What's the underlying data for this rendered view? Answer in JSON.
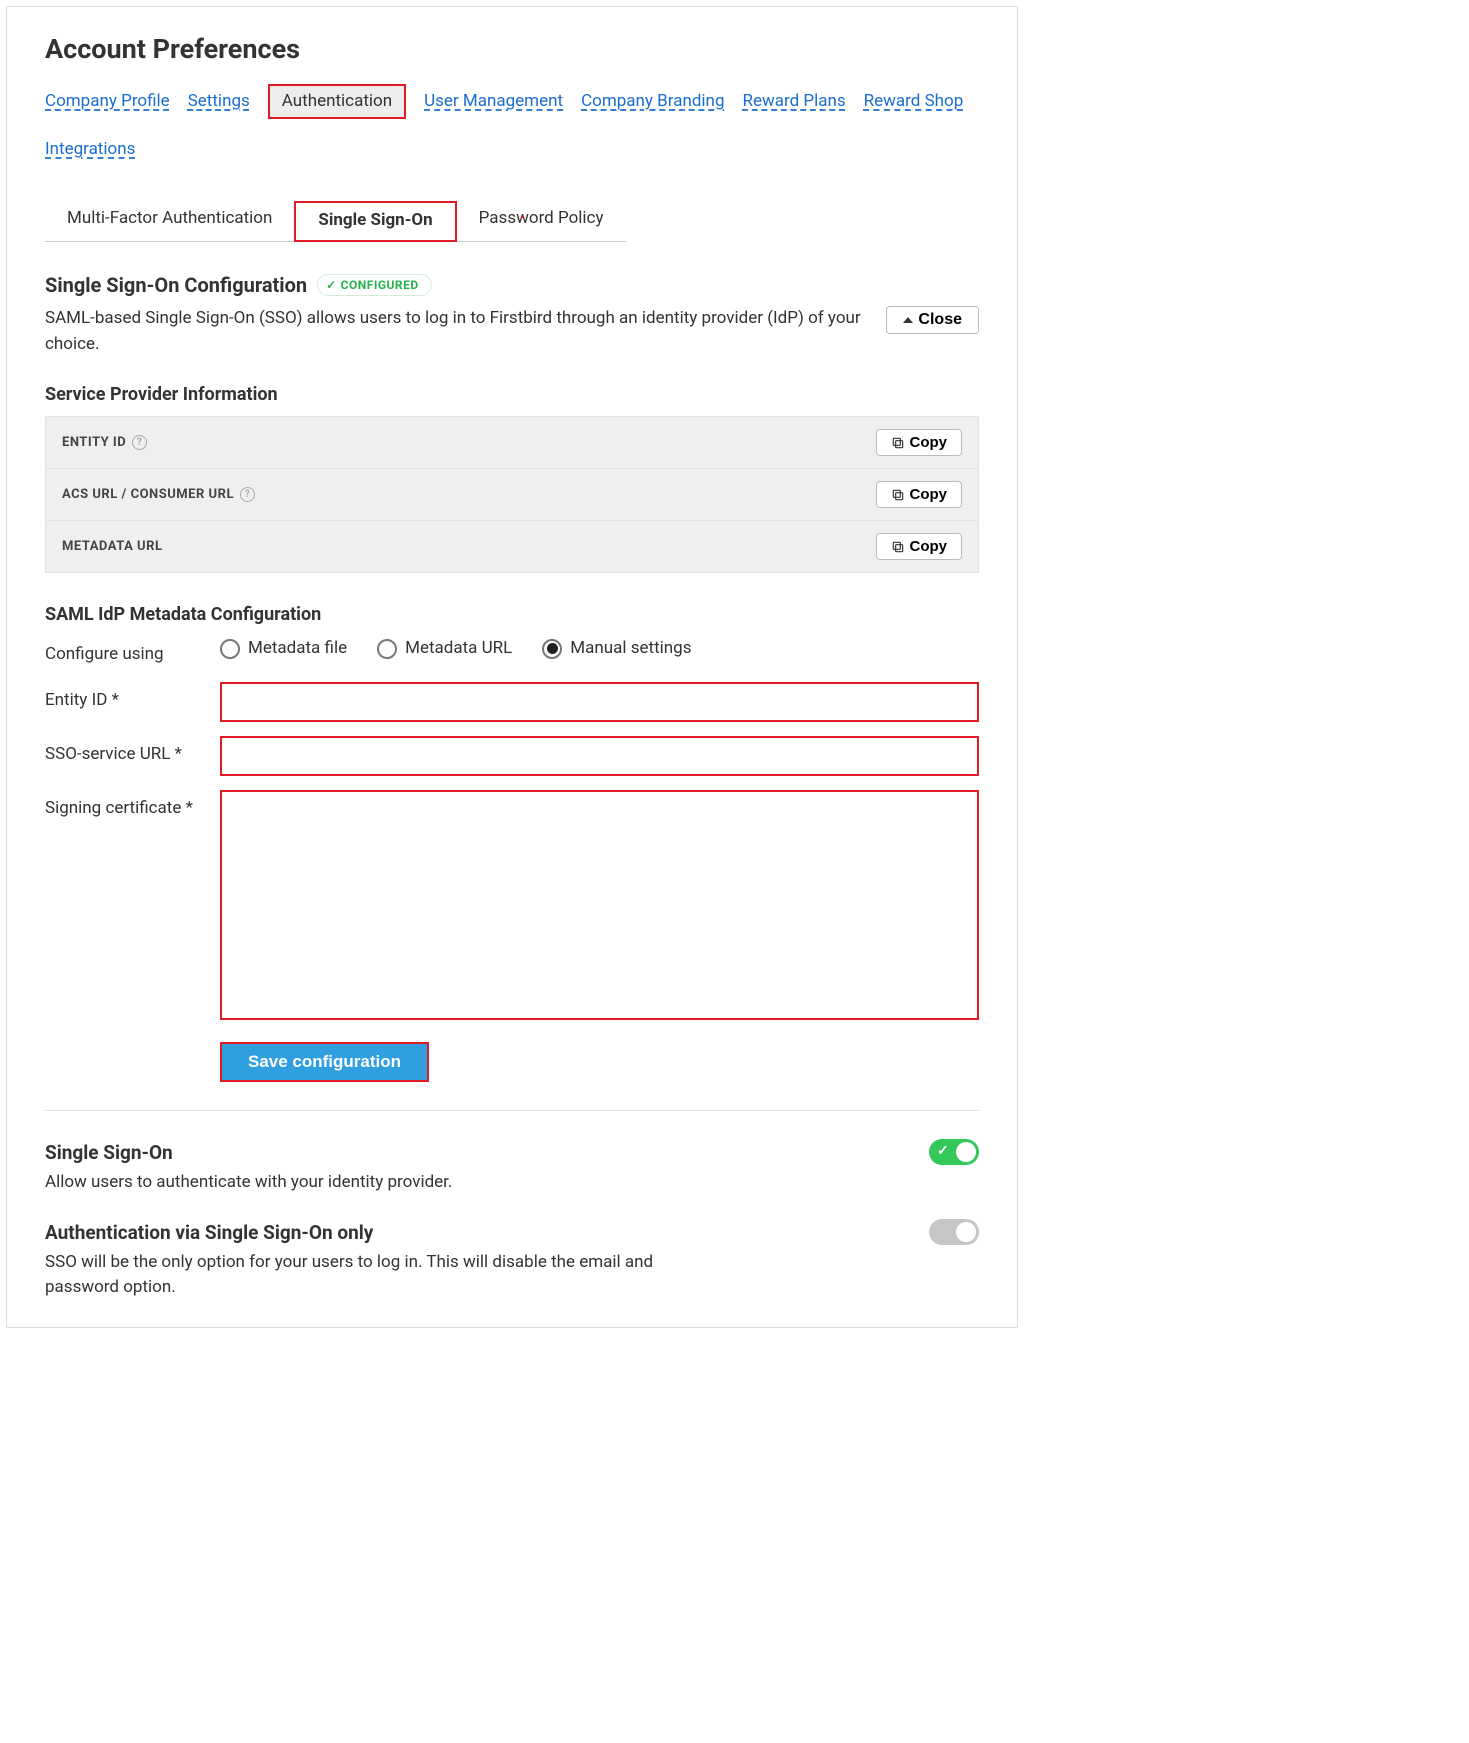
{
  "page_title": "Account Preferences",
  "top_nav": {
    "items": [
      {
        "label": "Company Profile"
      },
      {
        "label": "Settings"
      },
      {
        "label": "Authentication"
      },
      {
        "label": "User Management"
      },
      {
        "label": "Company Branding"
      },
      {
        "label": "Reward Plans"
      },
      {
        "label": "Reward Shop"
      },
      {
        "label": "Integrations"
      }
    ],
    "active_index": 2
  },
  "sub_tabs": {
    "items": [
      {
        "label": "Multi-Factor Authentication"
      },
      {
        "label": "Single Sign-On"
      },
      {
        "label": "Password Policy"
      }
    ],
    "active_index": 1
  },
  "sso_section": {
    "title": "Single Sign-On Configuration",
    "badge": "CONFIGURED",
    "description": "SAML-based Single Sign-On (SSO) allows users to log in to Firstbird through an identity provider (IdP) of your choice.",
    "close_label": "Close"
  },
  "sp_info": {
    "heading": "Service Provider Information",
    "rows": [
      {
        "label": "ENTITY ID",
        "help": true
      },
      {
        "label": "ACS URL / CONSUMER URL",
        "help": true
      },
      {
        "label": "METADATA URL",
        "help": false
      }
    ],
    "copy_label": "Copy"
  },
  "idp_config": {
    "heading": "SAML IdP Metadata Configuration",
    "configure_label": "Configure using",
    "radios": [
      {
        "label": "Metadata file",
        "checked": false
      },
      {
        "label": "Metadata URL",
        "checked": false
      },
      {
        "label": "Manual settings",
        "checked": true
      }
    ],
    "fields": {
      "entity_id_label": "Entity ID *",
      "sso_url_label": "SSO-service URL *",
      "cert_label": "Signing certificate *"
    },
    "save_label": "Save configuration"
  },
  "toggles": {
    "sso": {
      "title": "Single Sign-On",
      "desc": "Allow users to authenticate with your identity provider.",
      "on": true
    },
    "sso_only": {
      "title": "Authentication via Single Sign-On only",
      "desc": "SSO will be the only option for your users to log in. This will disable the email and password option.",
      "on": false
    }
  }
}
